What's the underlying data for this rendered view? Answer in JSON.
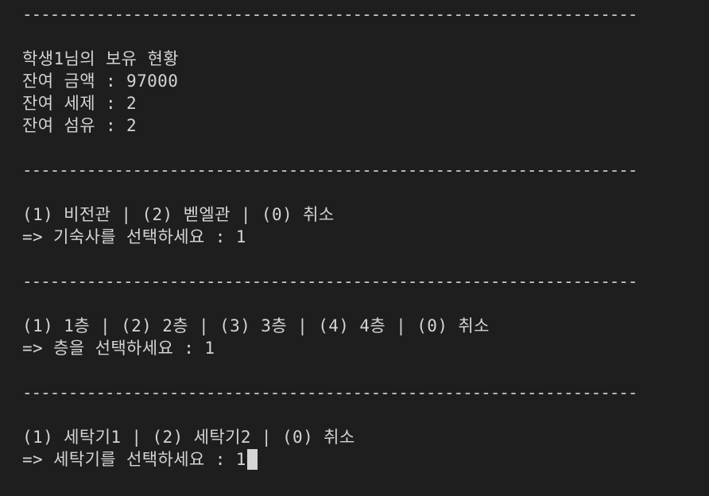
{
  "terminal": {
    "separator": "------------------------------------------------------------------------------------------",
    "status": {
      "title": "학생1님의 보유 현황",
      "balance": "잔여 금액 : 97000",
      "detergent": "잔여 세제 : 2",
      "softener": "잔여 섬유 : 2"
    },
    "dorm": {
      "options": "(1) 비전관 | (2) 벧엘관 | (0) 취소",
      "prompt": "=> 기숙사를 선택하세요 : 1"
    },
    "floor": {
      "options": "(1) 1층 | (2) 2층 | (3) 3층 | (4) 4층 | (0) 취소",
      "prompt": "=> 층을 선택하세요 : 1"
    },
    "washer": {
      "options": "(1) 세탁기1 | (2) 세탁기2 | (0) 취소",
      "prompt": "=> 세탁기를 선택하세요 : 1"
    }
  }
}
